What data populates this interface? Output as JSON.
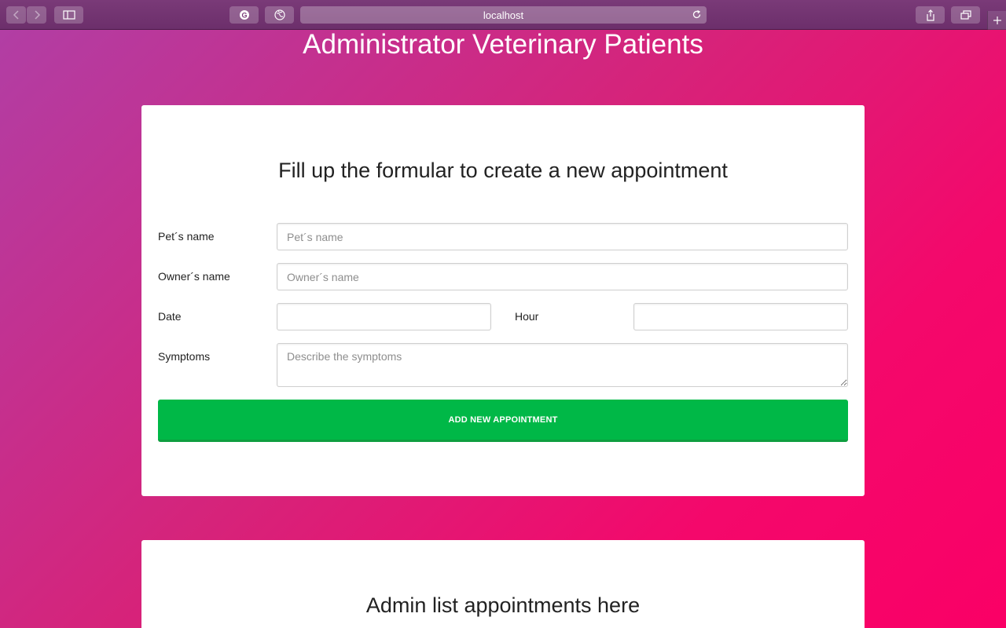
{
  "browser": {
    "url": "localhost"
  },
  "page": {
    "title": "Administrator Veterinary Patients"
  },
  "form": {
    "heading": "Fill up the formular to create a new appointment",
    "pet_label": "Pet´s name",
    "pet_placeholder": "Pet´s name",
    "owner_label": "Owner´s name",
    "owner_placeholder": "Owner´s name",
    "date_label": "Date",
    "hour_label": "Hour",
    "symptoms_label": "Symptoms",
    "symptoms_placeholder": "Describe the symptoms",
    "submit_label": "ADD NEW APPOINTMENT"
  },
  "list": {
    "heading": "Admin list appointments here"
  },
  "colors": {
    "accent": "#00b847",
    "background_start": "#b03fa6",
    "background_end": "#fa0066"
  }
}
